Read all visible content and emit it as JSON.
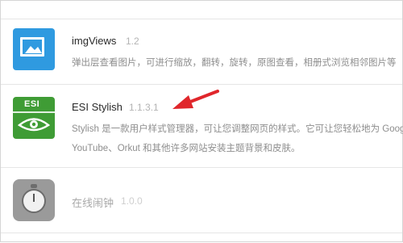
{
  "extensions": [
    {
      "name": "imgViews",
      "version": "1.2",
      "description_lines": [
        "弹出层查看图片，可进行缩放，翻转，旋转，原图查看，相册式浏览相邻图片等"
      ],
      "icon": "image-icon",
      "color": "#2f9ae0",
      "enabled": true
    },
    {
      "name": "ESI Stylish",
      "version": "1.1.3.1",
      "description_lines": [
        "Stylish 是一款用户样式管理器，可让您调整网页的样式。它可让您轻松地为 Google、",
        "YouTube、Orkut 和其他许多网站安装主题背景和皮肤。"
      ],
      "icon": "esi-eye-icon",
      "icon_label": "ESI",
      "color": "#3f9c35",
      "enabled": true
    },
    {
      "name": "在线闹钟",
      "version": "1.0.0",
      "description_lines": [],
      "icon": "stopwatch-icon",
      "color": "#9a9a9a",
      "enabled": false
    }
  ],
  "annotation": {
    "icon": "red-arrow-pointer",
    "color": "#e0262b"
  }
}
